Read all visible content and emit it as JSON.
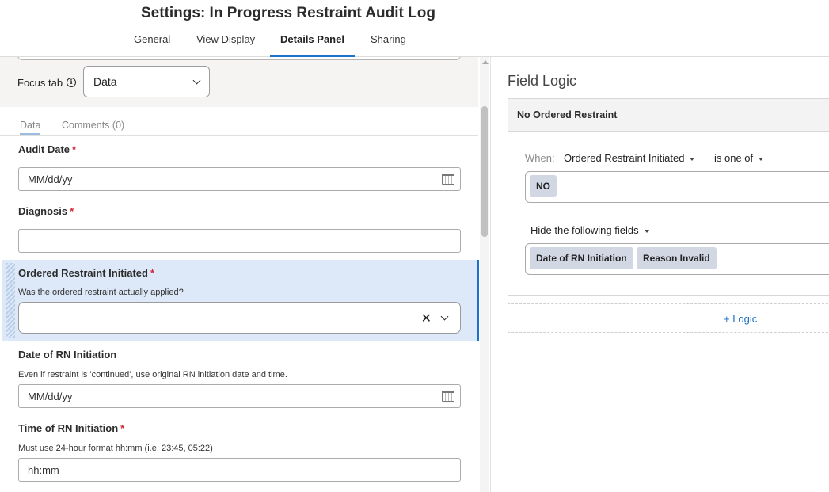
{
  "header": {
    "title": "Settings: In Progress Restraint Audit Log",
    "tabs": [
      "General",
      "View Display",
      "Details Panel",
      "Sharing"
    ],
    "active_tab": "Details Panel"
  },
  "left": {
    "focus_tab_label": "Focus tab",
    "focus_tab_value": "Data",
    "subtabs": [
      "Data",
      "Comments (0)"
    ],
    "required_marker": "*",
    "fields": [
      {
        "label": "Audit Date",
        "required": true,
        "value": "MM/dd/yy",
        "type": "date"
      },
      {
        "label": "Diagnosis",
        "required": true,
        "value": "",
        "type": "text"
      },
      {
        "label": "Ordered Restraint Initiated",
        "required": true,
        "hint": "Was the ordered restraint actually applied?",
        "value": "",
        "type": "select",
        "selected": true
      },
      {
        "label": "Date of RN Initiation",
        "required": false,
        "hint": "Even if restraint is 'continued', use original RN initiation date and time.",
        "value": "MM/dd/yy",
        "type": "date"
      },
      {
        "label": "Time of RN Initiation",
        "required": true,
        "hint": "Must use 24-hour format hh:mm (i.e. 23:45, 05:22)",
        "value": "hh:mm",
        "type": "text"
      }
    ],
    "clear_glyph": "✕"
  },
  "right": {
    "title": "Field Logic",
    "rule": {
      "name": "No Ordered Restraint",
      "when_label": "When:",
      "field": "Ordered Restraint Initiated",
      "operator": "is one of",
      "values": [
        "NO"
      ],
      "action": "Hide the following fields",
      "targets": [
        "Date of RN Initiation",
        "Reason Invalid"
      ]
    },
    "add_logic": "+ Logic"
  },
  "colors": {
    "accent": "#1a73c9",
    "selected_bg": "#dde9f8",
    "required": "#d2263a",
    "tag_bg": "#d2d7e4"
  }
}
